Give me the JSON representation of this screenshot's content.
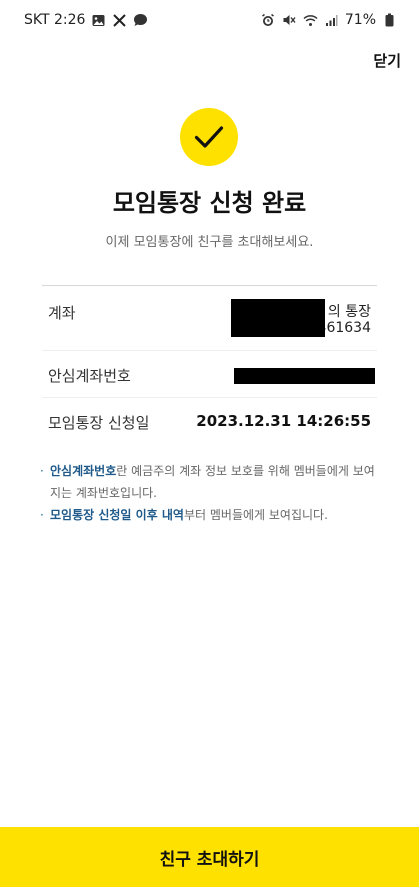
{
  "status_bar": {
    "carrier_time": "SKT 2:26",
    "battery": "71%"
  },
  "header": {
    "close_label": "닫기"
  },
  "completion": {
    "title": "모임통장 신청 완료",
    "subtitle": "이제 모임통장에 친구를 초대해보세요."
  },
  "info": {
    "account_label": "계좌",
    "account_suffix_1": "의 통장",
    "account_suffix_2": "461634",
    "safe_account_label": "안심계좌번호",
    "apply_date_label": "모임통장 신청일",
    "apply_date_value": "2023.12.31 14:26:55"
  },
  "notes": {
    "note1_em": "안심계좌번호",
    "note1_rest": "란 예금주의 계좌 정보 보호를 위해 멤버들에게 보여지는 계좌번호입니다.",
    "note2_em": "모임통장 신청일 이후 내역",
    "note2_rest": "부터 멤버들에게 보여집니다."
  },
  "footer": {
    "invite_label": "친구 초대하기"
  },
  "colors": {
    "accent": "#ffe100",
    "highlight_text": "#1f5a8a"
  },
  "icons": [
    "image-icon",
    "x-logo-icon",
    "chat-icon",
    "alarm-icon",
    "mute-icon",
    "wifi-icon",
    "signal-icon",
    "battery-icon",
    "check-icon"
  ]
}
